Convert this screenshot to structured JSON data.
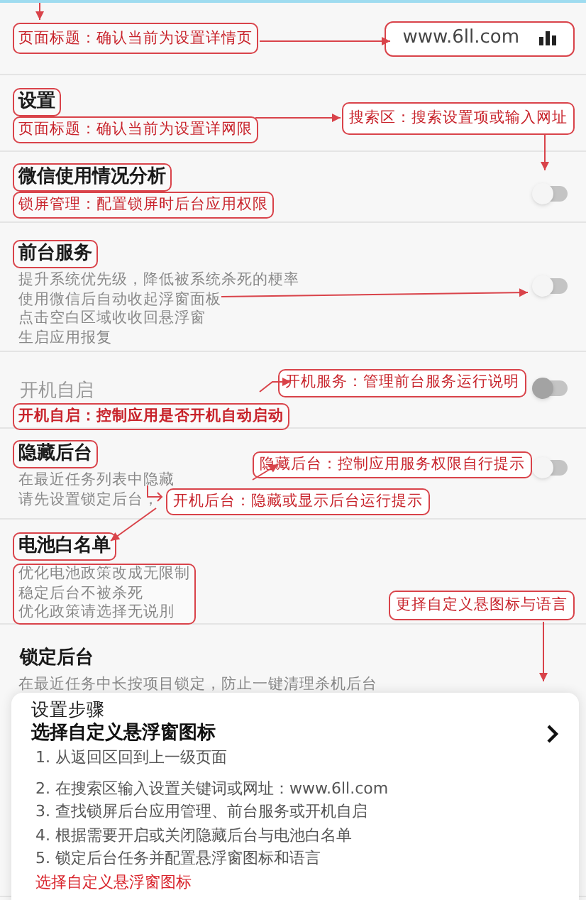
{
  "header": {
    "note": "页面标题：确认当前为设置详情页",
    "url": "www.6ll.com"
  },
  "rows": [
    {
      "title": "设置",
      "title_boxed": true,
      "disabled": false,
      "note": "页面标题：确认当前为设置详网限",
      "note_bold": false
    },
    {
      "title": "微信使用情况分析",
      "title_boxed": true,
      "disabled": false,
      "note": "锁屏管理：配置锁屏时后台应用权限",
      "note_bold": false,
      "toggle": {
        "on": false,
        "disabled": false
      }
    },
    {
      "title": "前台服务",
      "title_boxed": true,
      "disabled": false,
      "desc": [
        "提升系统优先级，降低被系统杀死的梗率",
        "使用微信后自动收起浮窗面板",
        "点击空白区域收收回悬浮窗",
        "生启应用报复"
      ],
      "desc_boxed": false,
      "toggle": {
        "on": false,
        "disabled": false
      }
    },
    {
      "title": "开机自启",
      "title_boxed": false,
      "disabled": true,
      "note": "开机自启：控制应用是否开机自动启动",
      "note_bold": true,
      "toggle": {
        "on": false,
        "disabled": true
      }
    },
    {
      "title": "隐藏后台",
      "title_boxed": true,
      "disabled": false,
      "desc": [
        "在最近任务列表中隐藏",
        "请先设置锁定后台，"
      ],
      "desc_boxed": false,
      "toggle": {
        "on": false,
        "disabled": false
      }
    },
    {
      "title": "电池白名单",
      "title_boxed": true,
      "disabled": false,
      "desc": [
        "优化电池政策改成无限制",
        "稳定后台不被杀死",
        "优化政策请选择无说刖"
      ],
      "desc_boxed": true
    },
    {
      "title": "锁定后台",
      "title_boxed": false,
      "disabled": false,
      "desc": [
        "在最近任务中长按项目锁定，防止一键清理杀机后台"
      ],
      "desc_boxed": false
    }
  ],
  "callouts": [
    "搜索区：搜索设置项或输入网址",
    "开机服务：管理前台服务运行说明",
    "隐藏后台：控制应用服务权限自行提示",
    "开机后台：隐藏或显示后台运行提示",
    "更择自定义悬图标与语言"
  ],
  "card": {
    "title": "设置步骤",
    "subtitle": "选择自定义悬浮窗图标",
    "steps": [
      "1. 从返回区回到上一级页面",
      "2. 在搜索区输入设置关键词或网址：www.6ll.com",
      "3. 查找锁屏后台应用管理、前台服务或开机自启",
      "4. 根据需要开启或关闭隐藏后台与电池白名单",
      "5. 锁定后台任务并配置悬浮窗图标和语言"
    ],
    "link": "选择自定义悬浮窗图标"
  }
}
